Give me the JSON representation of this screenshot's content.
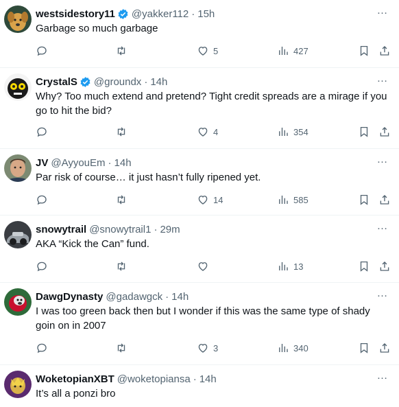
{
  "tweets": [
    {
      "name": "westsidestory11",
      "verified": true,
      "handle": "@yakker112",
      "time": "15h",
      "text": "Garbage so much garbage",
      "replies": "",
      "retweets": "",
      "likes": "5",
      "views": "427"
    },
    {
      "name": "CrystalS",
      "verified": true,
      "handle": "@groundx",
      "time": "14h",
      "text": "Why? Too much extend and pretend? Tight credit spreads are a mirage if you go to hit the bid?",
      "replies": "",
      "retweets": "",
      "likes": "4",
      "views": "354"
    },
    {
      "name": "JV",
      "verified": false,
      "handle": "@AyyouEm",
      "time": "14h",
      "text": "Par risk of course… it just hasn’t fully ripened yet.",
      "replies": "",
      "retweets": "",
      "likes": "14",
      "views": "585"
    },
    {
      "name": "snowytrail",
      "verified": false,
      "handle": "@snowytrail1",
      "time": "29m",
      "text": "AKA “Kick the Can” fund.",
      "replies": "",
      "retweets": "",
      "likes": "",
      "views": "13"
    },
    {
      "name": "DawgDynasty",
      "verified": false,
      "handle": "@gadawgck",
      "time": "14h",
      "text": "I was too green back then but I wonder if this was the same type of shady goin on in 2007",
      "replies": "",
      "retweets": "",
      "likes": "3",
      "views": "340"
    },
    {
      "name": "WoketopianXBT",
      "verified": false,
      "handle": "@woketopiansa",
      "time": "14h",
      "text": "It’s all a ponzi bro"
    }
  ],
  "colors": {
    "verified": "#1d9bf0",
    "muted": "#536471",
    "text": "#0f1419",
    "divider": "#eff3f4"
  },
  "icons": [
    "reply-icon",
    "retweet-icon",
    "like-icon",
    "views-icon",
    "bookmark-icon",
    "share-icon",
    "more-icon",
    "verified-icon"
  ]
}
